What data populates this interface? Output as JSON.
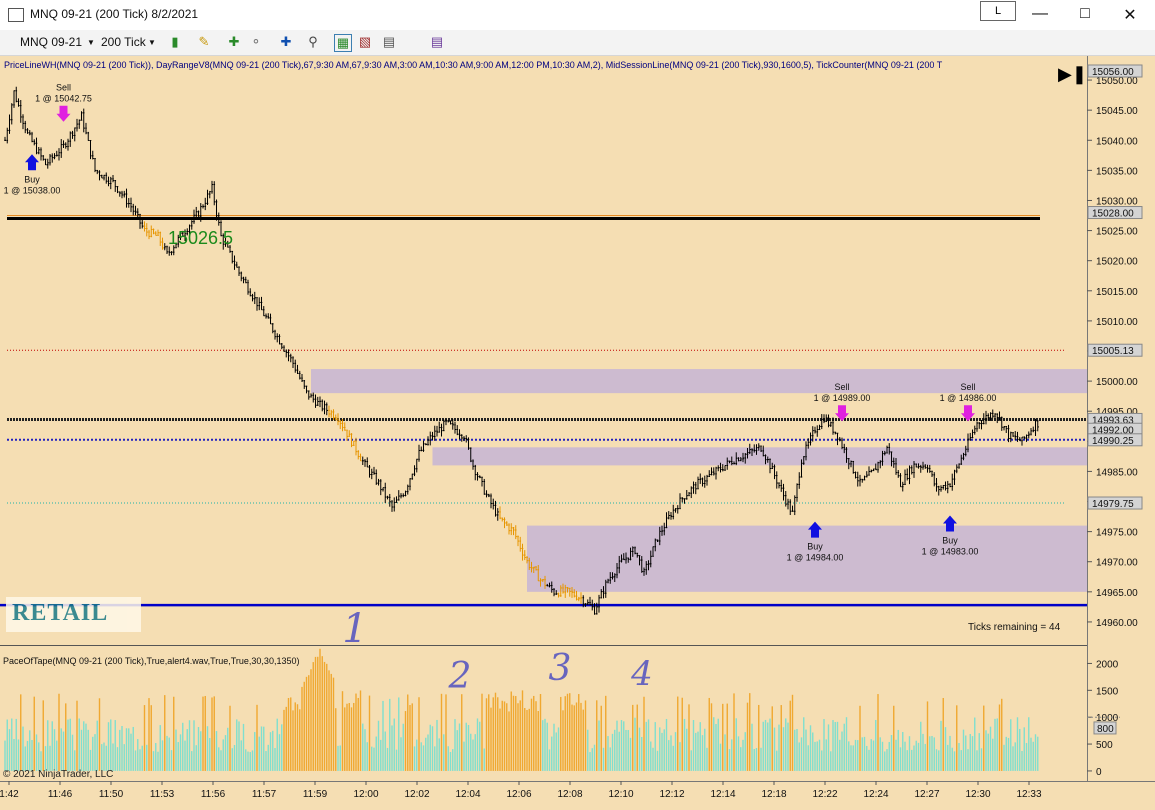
{
  "window": {
    "title": "MNQ 09-21 (200 Tick)  8/2/2021",
    "mode_badge": "L",
    "min_icon": "minimize-icon",
    "max_icon": "maximize-icon",
    "close_icon": "close-icon"
  },
  "toolbar": {
    "instrument": "MNQ 09-21",
    "interval": "200 Tick",
    "icons": [
      "bar-style-icon",
      "pencil-icon",
      "add-drawing-icon",
      "magnet-icon",
      "crosshair-icon",
      "zoom-icon",
      "strategy-icon",
      "data-box-icon",
      "chart-trader-icon",
      "properties-icon"
    ]
  },
  "indicators_line": "PriceLineWH(MNQ 09-21 (200 Tick)), DayRangeV8(MNQ 09-21 (200 Tick),67,9:30 AM,67,9:30 AM,3:00 AM,10:30 AM,9:00 AM,12:00 PM,10:30 AM,2), MidSessionLine(MNQ 09-21 (200 Tick),930,1600,5), TickCounter(MNQ 09-21 (200 T",
  "level_label": "15026.5",
  "retail_label": "RETAIL",
  "copyright": "© 2021 NinjaTrader, LLC",
  "ticks_remaining": "Ticks remaining = 44",
  "pace_label": "PaceOfTape(MNQ 09-21 (200 Tick),True,alert4.wav,True,True,30,30,1350)",
  "handwritten": [
    "1",
    "2",
    "3",
    "4"
  ],
  "colors": {
    "background": "#f5deb3",
    "candle": "#000000",
    "orange_candle": "#e69500",
    "zone": "#c9b7d3",
    "blue_line": "#0000c8",
    "red_dotted": "#c00000",
    "cyan_dotted": "#20b2aa",
    "buy_arrow": "#1010e0",
    "sell_arrow": "#e020e0",
    "pace_normal": "#7fdfcf",
    "pace_high": "#f0a830"
  },
  "chart_data": {
    "type": "candlestick",
    "price_axis": {
      "ticks": [
        15050,
        15045,
        15040,
        15035,
        15030,
        15025,
        15020,
        15015,
        15010,
        15005,
        15000,
        14995,
        14990,
        14985,
        14980,
        14975,
        14970,
        14965,
        14960
      ],
      "tick_labels": [
        "15050.00",
        "15045.00",
        "15040.00",
        "15035.00",
        "15030.00",
        "15025.00",
        "15020.00",
        "15015.00",
        "15010.00",
        "15005.00",
        "15000.00",
        "14995.00",
        "14990.00",
        "14985.00",
        "14980.00",
        "14975.00",
        "14970.00",
        "14965.00",
        "14960.00"
      ],
      "ylim": [
        14956.5,
        15053
      ]
    },
    "price_tags": [
      {
        "label": "15056.00",
        "value": 15056,
        "style": "gray"
      },
      {
        "label": "15028.00",
        "value": 15028,
        "style": "gray"
      },
      {
        "label": "15005.13",
        "value": 15005.13,
        "style": "gray"
      },
      {
        "label": "14993.63",
        "value": 14993.63,
        "style": "gray"
      },
      {
        "label": "14992.00",
        "value": 14992,
        "style": "gray"
      },
      {
        "label": "14990.25",
        "value": 14990.25,
        "style": "gray"
      },
      {
        "label": "14979.75",
        "value": 14979.75,
        "style": "gray"
      }
    ],
    "time_axis": {
      "labels": [
        "1:42",
        "11:46",
        "11:50",
        "11:53",
        "11:56",
        "11:57",
        "11:59",
        "12:00",
        "12:02",
        "12:04",
        "12:06",
        "12:08",
        "12:10",
        "12:12",
        "12:14",
        "12:18",
        "12:22",
        "12:24",
        "12:27",
        "12:30",
        "12:33"
      ]
    },
    "path": [
      [
        0,
        15040
      ],
      [
        4,
        15048
      ],
      [
        10,
        15041
      ],
      [
        18,
        15036
      ],
      [
        26,
        15039
      ],
      [
        34,
        15044
      ],
      [
        40,
        15035
      ],
      [
        48,
        15033
      ],
      [
        56,
        15029
      ],
      [
        62,
        15025
      ],
      [
        68,
        15024
      ],
      [
        72,
        15021
      ],
      [
        78,
        15024
      ],
      [
        86,
        15028
      ],
      [
        92,
        15032
      ],
      [
        96,
        15024
      ],
      [
        104,
        15018
      ],
      [
        112,
        15013
      ],
      [
        120,
        15008
      ],
      [
        128,
        15003
      ],
      [
        134,
        14998
      ],
      [
        140,
        14996
      ],
      [
        148,
        14994
      ],
      [
        154,
        14990
      ],
      [
        160,
        14986
      ],
      [
        166,
        14983
      ],
      [
        172,
        14979
      ],
      [
        178,
        14982
      ],
      [
        184,
        14988
      ],
      [
        190,
        14991
      ],
      [
        196,
        14993
      ],
      [
        204,
        14991
      ],
      [
        208,
        14986
      ],
      [
        214,
        14981
      ],
      [
        220,
        14977
      ],
      [
        226,
        14975
      ],
      [
        232,
        14970
      ],
      [
        238,
        14967
      ],
      [
        244,
        14965
      ],
      [
        250,
        14965
      ],
      [
        256,
        14964
      ],
      [
        262,
        14962
      ],
      [
        268,
        14967
      ],
      [
        274,
        14970
      ],
      [
        280,
        14972
      ],
      [
        284,
        14968
      ],
      [
        290,
        14974
      ],
      [
        296,
        14978
      ],
      [
        302,
        14981
      ],
      [
        308,
        14983
      ],
      [
        316,
        14985
      ],
      [
        324,
        14987
      ],
      [
        330,
        14988
      ],
      [
        336,
        14989
      ],
      [
        340,
        14986
      ],
      [
        346,
        14981
      ],
      [
        350,
        14978
      ],
      [
        354,
        14987
      ],
      [
        360,
        14992
      ],
      [
        364,
        14994
      ],
      [
        370,
        14991
      ],
      [
        376,
        14986
      ],
      [
        380,
        14983
      ],
      [
        386,
        14985
      ],
      [
        392,
        14989
      ],
      [
        398,
        14983
      ],
      [
        404,
        14986
      ],
      [
        410,
        14986
      ],
      [
        414,
        14982
      ],
      [
        420,
        14983
      ],
      [
        426,
        14988
      ],
      [
        432,
        14993
      ],
      [
        440,
        14995
      ],
      [
        446,
        14991
      ],
      [
        452,
        14990
      ],
      [
        458,
        14993
      ]
    ],
    "orange_ranges": [
      [
        62,
        70
      ],
      [
        144,
        158
      ],
      [
        220,
        240
      ],
      [
        246,
        256
      ]
    ],
    "horizontal_lines": [
      {
        "value": 15027.0,
        "style": "black-thick"
      },
      {
        "value": 15005.13,
        "style": "red-dotted"
      },
      {
        "value": 14993.63,
        "style": "black-dashed"
      },
      {
        "value": 14990.25,
        "style": "blue-dotted"
      },
      {
        "value": 14979.75,
        "style": "cyan-dotted"
      },
      {
        "value": 14962.8,
        "style": "blue-thick"
      }
    ],
    "zones": [
      {
        "x0": 136,
        "x1": 1000,
        "y0": 14998,
        "y1": 15002
      },
      {
        "x0": 190,
        "x1": 1000,
        "y0": 14986,
        "y1": 14989
      },
      {
        "x0": 232,
        "x1": 1000,
        "y0": 14965,
        "y1": 14976
      }
    ],
    "trades": [
      {
        "type": "Sell",
        "label": "Sell",
        "fill": "1 @ 15042.75",
        "i": 26,
        "price": 15042.75
      },
      {
        "type": "Buy",
        "label": "Buy",
        "fill": "1 @ 15038.00",
        "i": 12,
        "price": 15038.0
      },
      {
        "type": "Sell",
        "label": "Sell",
        "fill": "1 @ 14989.00",
        "i": 372,
        "price": 14993
      },
      {
        "type": "Buy",
        "label": "Buy",
        "fill": "1 @ 14984.00",
        "i": 360,
        "price": 14977
      },
      {
        "type": "Sell",
        "label": "Sell",
        "fill": "1 @ 14986.00",
        "i": 428,
        "price": 14993
      },
      {
        "type": "Buy",
        "label": "Buy",
        "fill": "1 @ 14983.00",
        "i": 420,
        "price": 14978
      }
    ],
    "pace": {
      "axis_ticks": [
        2000,
        1500,
        1000,
        500,
        0
      ],
      "axis_labels": [
        "2000",
        "1500",
        "1000",
        "500",
        "0"
      ],
      "threshold": 1350,
      "current_tag": "800",
      "ylim": [
        -150,
        2250
      ]
    }
  }
}
